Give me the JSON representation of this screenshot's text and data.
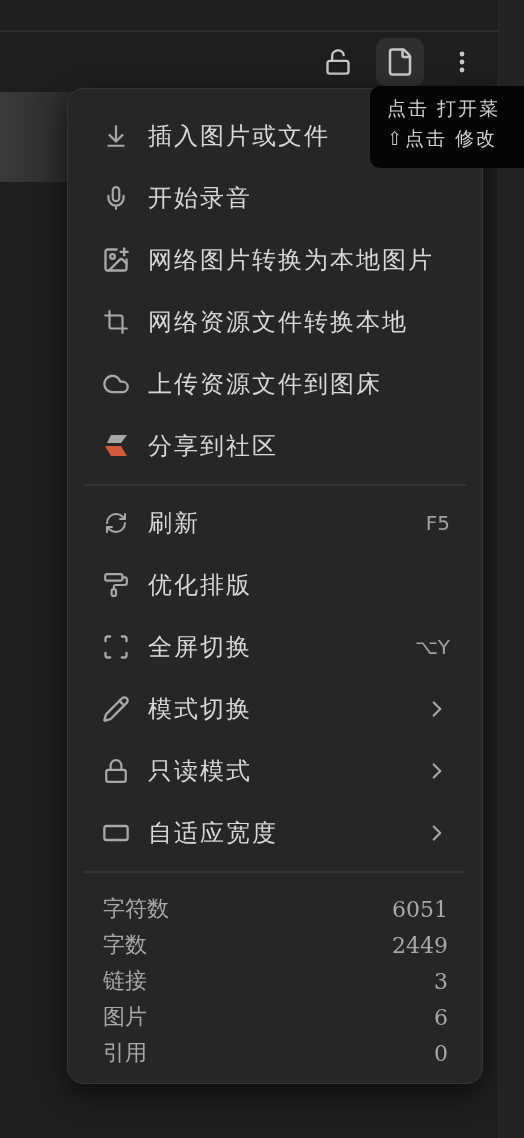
{
  "toolbar": {
    "buttons": [
      {
        "selected": false
      },
      {
        "selected": true
      },
      {
        "selected": false
      }
    ]
  },
  "tooltip": {
    "lines": [
      "点击 打开菜",
      "⇧点击 修改"
    ]
  },
  "menu": {
    "groups": [
      [
        {
          "label": "插入图片或文件",
          "submenu": false
        },
        {
          "label": "开始录音",
          "submenu": false
        },
        {
          "label": "网络图片转换为本地图片",
          "submenu": false
        },
        {
          "label": "网络资源文件转换本地",
          "submenu": false
        },
        {
          "label": "上传资源文件到图床",
          "submenu": false
        },
        {
          "label": "分享到社区",
          "submenu": false
        }
      ],
      [
        {
          "label": "刷新",
          "shortcut": "F5",
          "submenu": false
        },
        {
          "label": "优化排版",
          "submenu": false
        },
        {
          "label": "全屏切换",
          "shortcut": "⌥Y",
          "submenu": false
        },
        {
          "label": "模式切换",
          "submenu": true
        },
        {
          "label": "只读模式",
          "submenu": true
        },
        {
          "label": "自适应宽度",
          "submenu": true
        }
      ]
    ],
    "stats": [
      {
        "label": "字符数",
        "value": "6051"
      },
      {
        "label": "字数",
        "value": "2449"
      },
      {
        "label": "链接",
        "value": "3"
      },
      {
        "label": "图片",
        "value": "6"
      },
      {
        "label": "引用",
        "value": "0"
      }
    ]
  }
}
